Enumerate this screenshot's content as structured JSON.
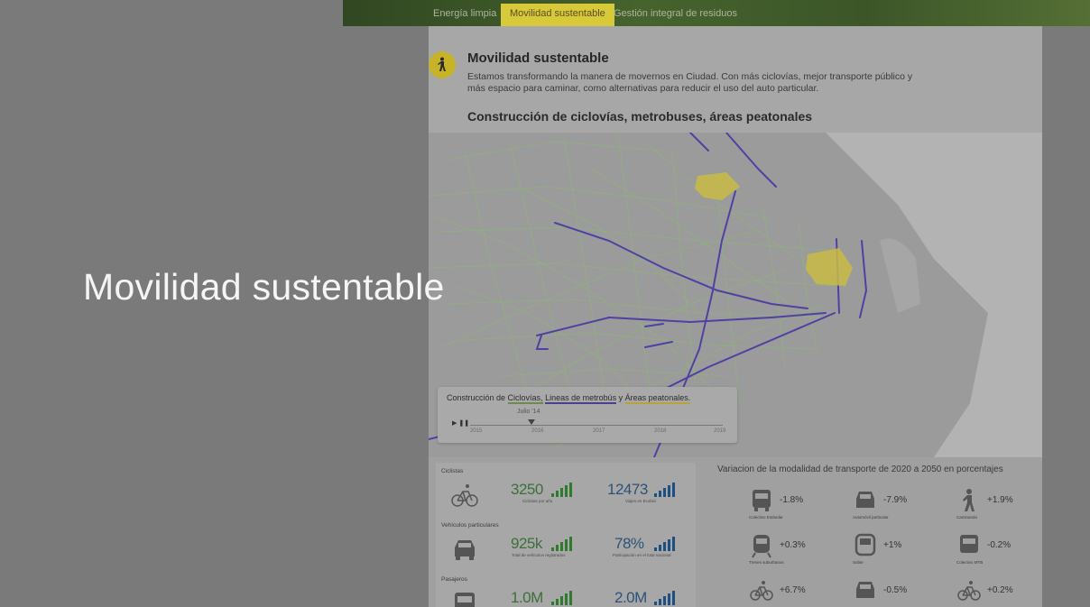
{
  "topnav": {
    "tabs": [
      {
        "label": "Energía limpia",
        "active": false
      },
      {
        "label": "Movilidad sustentable",
        "active": true
      },
      {
        "label": "Gestión integral de residuos",
        "active": false
      }
    ]
  },
  "header": {
    "title": "Movilidad sustentable",
    "description": "Estamos transformando la manera de movernos en Ciudad. Con más ciclovías, mejor transporte público y más espacio para caminar, como alternativas para reducir el uso del auto particular.",
    "subtitle": "Construcción de ciclovías, metrobuses, áreas peatonales"
  },
  "timeline": {
    "caption_pre": "Construcción de ",
    "caption_l1": "Ciclovías,",
    "caption_mid": " ",
    "caption_l2": "Lineas de metrobús",
    "caption_and": " y ",
    "caption_l3": "Áreas peatonales.",
    "current": "Julio '14",
    "years": [
      "2015",
      "2016",
      "2017",
      "2018",
      "2019"
    ],
    "play_label": "▶ ❚❚",
    "colors": {
      "ciclovias": "#6e8a4f",
      "metrobus": "#4b3f8e",
      "peatonales": "#b8a23a"
    }
  },
  "stats": {
    "ciclistas": {
      "label": "Ciclistas",
      "value1": "3250",
      "caption1": "Ciclistas por año",
      "value2": "12473",
      "caption2": "Viajes en Ecobici"
    },
    "vehiculos": {
      "label": "Vehículos particulares",
      "value1": "925k",
      "caption1": "Total de vehículos registrados",
      "value2": "78%",
      "caption2": "Participación en el total nacional"
    },
    "pasajeros": {
      "label": "Pasajeros",
      "value1": "1.0M",
      "value2": "2.0M"
    }
  },
  "variation": {
    "title": "Variacion de la modalidad de transporte de 2020 a 2050 en porcentajes",
    "items": [
      {
        "icon": "bus-icon",
        "value": "-1.8%",
        "label": "Colectivo Estándar"
      },
      {
        "icon": "car-icon",
        "value": "-7.9%",
        "label": "Automóvil particular"
      },
      {
        "icon": "walking-icon",
        "value": "+1.9%",
        "label": "Caminando"
      },
      {
        "icon": "train-icon",
        "value": "+0.3%",
        "label": "Trenes suburbanos"
      },
      {
        "icon": "subway-icon",
        "value": "+1%",
        "label": "Subte"
      },
      {
        "icon": "bus-icon",
        "value": "-0.2%",
        "label": "Colectivo MTB"
      },
      {
        "icon": "bicycle-icon",
        "value": "+6.7%",
        "label": ""
      },
      {
        "icon": "car-icon",
        "value": "-0.5%",
        "label": ""
      },
      {
        "icon": "bicycle-icon",
        "value": "+0.2%",
        "label": ""
      }
    ]
  },
  "overlay": {
    "title": "Movilidad sustentable"
  },
  "colors": {
    "accent": "#c7b327",
    "green_bars": "#2f7a2f",
    "blue_bars": "#1e4f82",
    "metrobus": "#4b3f8e",
    "ciclovia": "#7ea866"
  }
}
